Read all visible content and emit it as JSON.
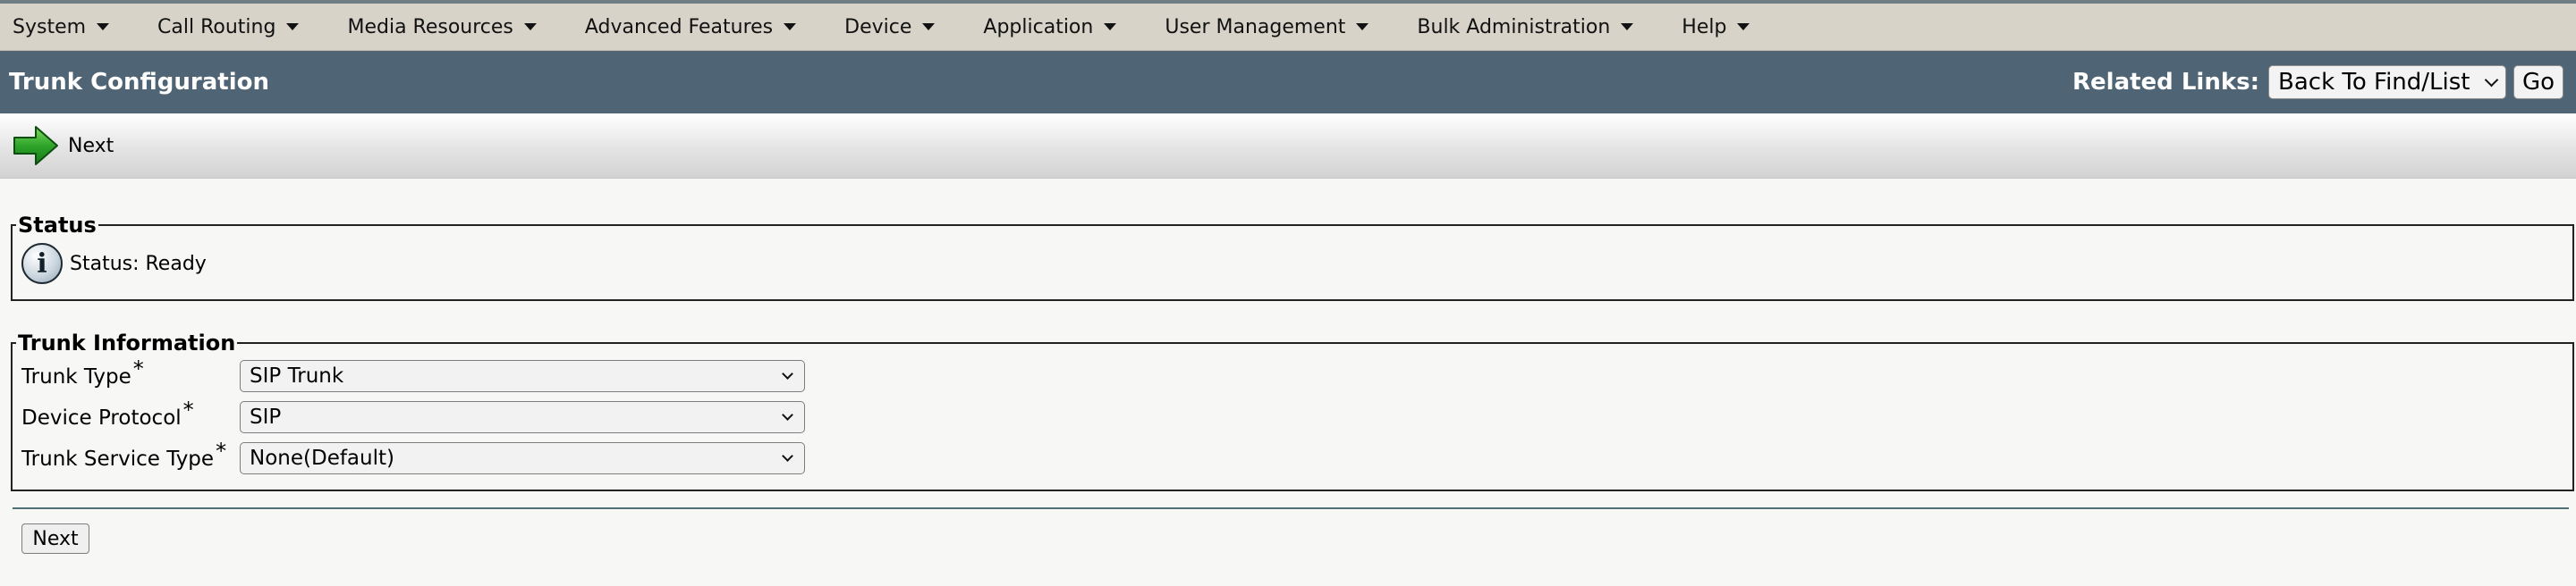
{
  "menu": {
    "items": [
      {
        "label": "System"
      },
      {
        "label": "Call Routing"
      },
      {
        "label": "Media Resources"
      },
      {
        "label": "Advanced Features"
      },
      {
        "label": "Device"
      },
      {
        "label": "Application"
      },
      {
        "label": "User Management"
      },
      {
        "label": "Bulk Administration"
      },
      {
        "label": "Help"
      }
    ]
  },
  "header": {
    "title": "Trunk Configuration",
    "related_links_label": "Related Links:",
    "related_links_value": "Back To Find/List",
    "go_label": "Go"
  },
  "toolbar": {
    "next_label": "Next"
  },
  "status": {
    "legend": "Status",
    "text": "Status: Ready"
  },
  "trunk_info": {
    "legend": "Trunk Information",
    "fields": [
      {
        "label": "Trunk Type",
        "required": "*",
        "value": "SIP Trunk"
      },
      {
        "label": "Device Protocol",
        "required": "*",
        "value": "SIP"
      },
      {
        "label": "Trunk Service Type",
        "required": "*",
        "value": "None(Default)"
      }
    ]
  },
  "footer": {
    "next_label": "Next"
  },
  "colors": {
    "menubar": "#d7d3c8",
    "titlebar": "#4f6575",
    "arrow": "#2ea42a"
  }
}
